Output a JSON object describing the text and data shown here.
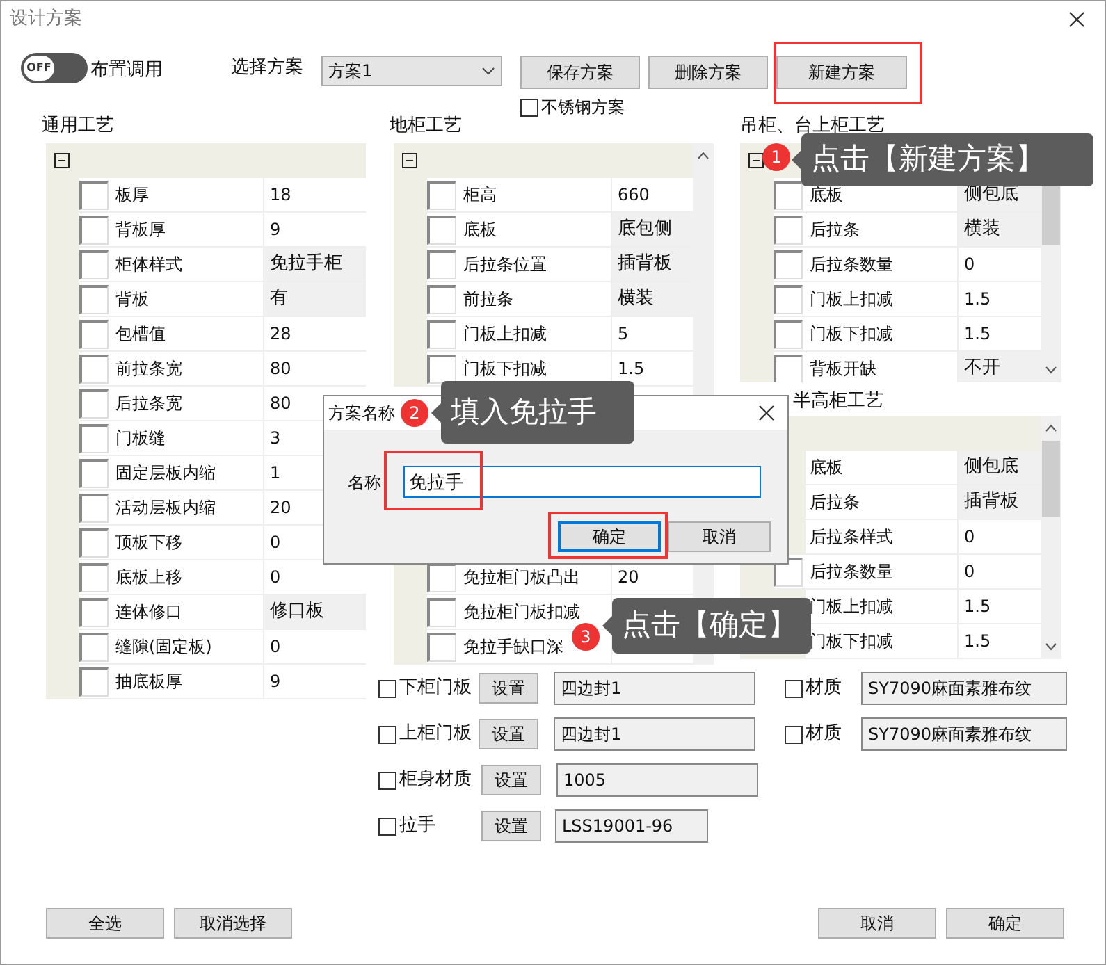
{
  "window": {
    "title": "设计方案"
  },
  "toggle": {
    "text": "OFF",
    "on": false,
    "label": "布置调用"
  },
  "scheme": {
    "label": "选择方案",
    "value": "方案1"
  },
  "buttons": [
    {
      "label": "保存方案",
      "highlighted": false
    },
    {
      "label": "删除方案",
      "highlighted": false
    },
    {
      "label": "新建方案",
      "highlighted": true
    }
  ],
  "stainless": {
    "label": "不锈钢方案",
    "checked": false
  },
  "panels": [
    {
      "title": "通用工艺",
      "rows": [
        {
          "label": "板厚",
          "value": "18",
          "kind": "text",
          "checked": false
        },
        {
          "label": "背板厚",
          "value": "9",
          "kind": "text",
          "checked": false
        },
        {
          "label": "柜体样式",
          "value": "免拉手柜",
          "kind": "select",
          "checked": false
        },
        {
          "label": "背板",
          "value": "有",
          "kind": "select",
          "checked": false
        },
        {
          "label": "包槽值",
          "value": "28",
          "kind": "text",
          "checked": false
        },
        {
          "label": "前拉条宽",
          "value": "80",
          "kind": "text",
          "checked": false
        },
        {
          "label": "后拉条宽",
          "value": "80",
          "kind": "text",
          "checked": false
        },
        {
          "label": "门板缝",
          "value": "3",
          "kind": "text",
          "checked": false
        },
        {
          "label": "固定层板内缩",
          "value": "1",
          "kind": "text",
          "checked": false
        },
        {
          "label": "活动层板内缩",
          "value": "20",
          "kind": "text",
          "checked": false
        },
        {
          "label": "顶板下移",
          "value": "0",
          "kind": "text",
          "checked": false
        },
        {
          "label": "底板上移",
          "value": "0",
          "kind": "text",
          "checked": false
        },
        {
          "label": "连体修口",
          "value": "修口板",
          "kind": "select",
          "checked": false
        },
        {
          "label": "缝隙(固定板)",
          "value": "0",
          "kind": "text",
          "checked": false
        },
        {
          "label": "抽底板厚",
          "value": "9",
          "kind": "text",
          "checked": false
        }
      ]
    },
    {
      "title": "地柜工艺",
      "rows": [
        {
          "label": "柜高",
          "value": "660",
          "kind": "text",
          "checked": false
        },
        {
          "label": "底板",
          "value": "底包侧",
          "kind": "select",
          "checked": false
        },
        {
          "label": "后拉条位置",
          "value": "插背板",
          "kind": "select",
          "checked": false
        },
        {
          "label": "前拉条",
          "value": "横装",
          "kind": "select",
          "checked": false
        },
        {
          "label": "门板上扣减",
          "value": "5",
          "kind": "text",
          "checked": false
        },
        {
          "label": "门板下扣减",
          "value": "1.5",
          "kind": "text",
          "checked": false
        }
      ],
      "rows_below": [
        {
          "label": "免拉柜门板凸出",
          "value": "20",
          "checked": false
        },
        {
          "label": "免拉柜门板扣减",
          "checked": false
        },
        {
          "label": "免拉手缺口深",
          "checked": false
        }
      ]
    },
    {
      "title": "吊柜、台上柜工艺",
      "rows": [
        {
          "label": "底板",
          "value": "侧包底",
          "kind": "select",
          "checked": false
        },
        {
          "label": "后拉条",
          "value": "横装",
          "kind": "select",
          "checked": false
        },
        {
          "label": "后拉条数量",
          "value": "0",
          "kind": "text",
          "checked": false
        },
        {
          "label": "门板上扣减",
          "value": "1.5",
          "kind": "text",
          "checked": false
        },
        {
          "label": "门板下扣减",
          "value": "1.5",
          "kind": "text",
          "checked": false
        },
        {
          "label": "背板开缺",
          "value": "不开",
          "kind": "select",
          "checked": false
        }
      ]
    },
    {
      "title": "半高柜工艺",
      "rows": [
        {
          "label": "底板",
          "value": "侧包底",
          "kind": "select"
        },
        {
          "label": "后拉条",
          "value": "插背板",
          "kind": "select"
        },
        {
          "label": "后拉条样式",
          "value": "0",
          "kind": "text"
        },
        {
          "label": "后拉条数量",
          "value": "0",
          "kind": "text",
          "checked": false
        },
        {
          "label": "门板上扣减",
          "value": "1.5",
          "kind": "text"
        },
        {
          "label": "门板下扣减",
          "value": "1.5",
          "kind": "text"
        }
      ]
    }
  ],
  "materials": [
    {
      "label": "下柜门板",
      "checked": false,
      "button": "设置",
      "value": "四边封1",
      "material": {
        "label": "材质",
        "checked": false,
        "value": "SY7090麻面素雅布纹"
      }
    },
    {
      "label": "上柜门板",
      "checked": false,
      "button": "设置",
      "value": "四边封1",
      "material": {
        "label": "材质",
        "checked": false,
        "value": "SY7090麻面素雅布纹"
      }
    },
    {
      "label": "柜身材质",
      "checked": false,
      "button": "设置",
      "value": "1005"
    },
    {
      "label": "拉手",
      "checked": false,
      "button": "设置",
      "value": "LSS19001-96"
    }
  ],
  "footer_left": [
    "全选",
    "取消选择"
  ],
  "footer_right": [
    "取消",
    "确定"
  ],
  "dialog": {
    "title": "方案名称",
    "field_label": "名称",
    "value": "免拉手",
    "value_highlighted": true,
    "buttons": [
      {
        "label": "确定",
        "focused": true,
        "highlighted": true
      },
      {
        "label": "取消",
        "focused": false,
        "highlighted": false
      }
    ]
  },
  "callouts": [
    {
      "number": "1",
      "text": "点击【新建方案】"
    },
    {
      "number": "2",
      "text": "填入免拉手"
    },
    {
      "number": "3",
      "text": "点击【确定】"
    }
  ]
}
